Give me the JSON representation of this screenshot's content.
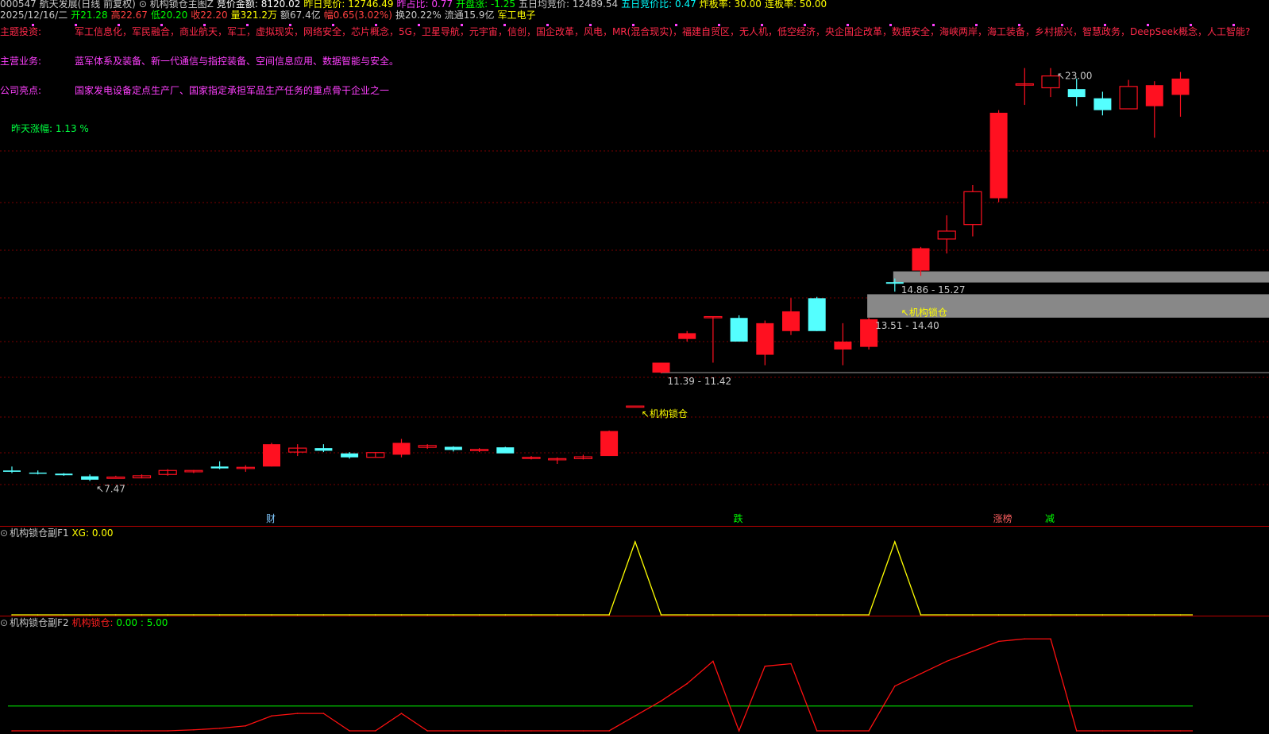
{
  "header": {
    "row1": [
      {
        "t": "000547 航天发展(日线 前复权)",
        "c": "#c8c8c8"
      },
      {
        "t": "⊙ 机构锁仓主图Z",
        "c": "#c8c8c8"
      },
      {
        "t": "竞价金额: 8120.02",
        "c": "#ffffff"
      },
      {
        "t": "昨日竞价: 12746.49",
        "c": "#ffff00"
      },
      {
        "t": "昨占比: 0.77",
        "c": "#ff40ff"
      },
      {
        "t": "开盘涨: -1.25",
        "c": "#00ff00"
      },
      {
        "t": "五日均竞价: 12489.54",
        "c": "#c8c8c8"
      },
      {
        "t": "五日竞价比: 0.47",
        "c": "#00ffff"
      },
      {
        "t": "炸板率: 30.00",
        "c": "#ffff00"
      },
      {
        "t": "连板率: 50.00",
        "c": "#ffff00"
      }
    ],
    "row2": [
      {
        "t": "2025/12/16/二",
        "c": "#c8c8c8"
      },
      {
        "t": "开21.28",
        "c": "#00ff00"
      },
      {
        "t": "高22.67",
        "c": "#ff4040"
      },
      {
        "t": "低20.20",
        "c": "#00ff00"
      },
      {
        "t": "收22.20",
        "c": "#ff4040"
      },
      {
        "t": "量321.2万",
        "c": "#ffff00"
      },
      {
        "t": "额67.4亿",
        "c": "#c8c8c8"
      },
      {
        "t": "幅0.65(3.02%)",
        "c": "#ff4040"
      },
      {
        "t": "换20.22%",
        "c": "#c8c8c8"
      },
      {
        "t": "流通15.9亿",
        "c": "#c8c8c8"
      },
      {
        "t": "军工电子",
        "c": "#ffff00"
      }
    ]
  },
  "info": {
    "theme_label": "主题投资:",
    "theme_text": "军工信息化，军民融合，商业航天，军工，虚拟现实，网络安全，芯片概念，5G，卫星导航，元宇宙，信创，国企改革，风电，MR(混合现实)，福建自贸区，无人机，低空经济，央企国企改革，数据安全，海峡两岸，海工装备，乡村振兴，智慧政务，DeepSeek概念，人工智能?",
    "business_label": "主营业务:",
    "business_text": "蓝军体系及装备、新一代通信与指控装备、空间信息应用、数据智能与安全。",
    "highlight_label": "公司亮点:",
    "highlight_text": "国家发电设备定点生产厂、国家指定承担军品生产任务的重点骨干企业之一",
    "yesterday_text": "昨天涨幅: 1.13 %"
  },
  "colors": {
    "up": "#ff1020",
    "down": "#54ffff",
    "bg": "#000000",
    "grid": "#7a0000",
    "zone": "#888888",
    "xg": "#ffff00",
    "lock": "#ff1010",
    "green": "#00c800"
  },
  "chart_data": [
    {
      "type": "candlestick",
      "ylim": [
        6.5,
        24.5
      ],
      "candles": [
        {
          "o": 7.7,
          "h": 7.85,
          "l": 7.6,
          "c": 7.65
        },
        {
          "o": 7.62,
          "h": 7.7,
          "l": 7.55,
          "c": 7.6
        },
        {
          "o": 7.58,
          "h": 7.6,
          "l": 7.5,
          "c": 7.52
        },
        {
          "o": 7.48,
          "h": 7.55,
          "l": 7.3,
          "c": 7.35
        },
        {
          "o": 7.4,
          "h": 7.5,
          "l": 7.47,
          "c": 7.45
        },
        {
          "o": 7.42,
          "h": 7.55,
          "l": 7.4,
          "c": 7.5
        },
        {
          "o": 7.55,
          "h": 7.75,
          "l": 7.5,
          "c": 7.7
        },
        {
          "o": 7.65,
          "h": 7.72,
          "l": 7.6,
          "c": 7.7
        },
        {
          "o": 7.85,
          "h": 8.05,
          "l": 7.75,
          "c": 7.78
        },
        {
          "o": 7.8,
          "h": 7.9,
          "l": 7.65,
          "c": 7.82
        },
        {
          "o": 7.85,
          "h": 8.75,
          "l": 7.85,
          "c": 8.7
        },
        {
          "o": 8.4,
          "h": 8.7,
          "l": 8.25,
          "c": 8.55
        },
        {
          "o": 8.55,
          "h": 8.7,
          "l": 8.4,
          "c": 8.45
        },
        {
          "o": 8.35,
          "h": 8.4,
          "l": 8.15,
          "c": 8.2
        },
        {
          "o": 8.2,
          "h": 8.4,
          "l": 8.2,
          "c": 8.38
        },
        {
          "o": 8.3,
          "h": 8.9,
          "l": 8.2,
          "c": 8.75
        },
        {
          "o": 8.58,
          "h": 8.7,
          "l": 8.52,
          "c": 8.65
        },
        {
          "o": 8.6,
          "h": 8.62,
          "l": 8.42,
          "c": 8.48
        },
        {
          "o": 8.5,
          "h": 8.55,
          "l": 8.4,
          "c": 8.5
        },
        {
          "o": 8.58,
          "h": 8.6,
          "l": 8.36,
          "c": 8.35
        },
        {
          "o": 8.2,
          "h": 8.25,
          "l": 8.12,
          "c": 8.2
        },
        {
          "o": 8.12,
          "h": 8.2,
          "l": 7.95,
          "c": 8.15
        },
        {
          "o": 8.15,
          "h": 8.3,
          "l": 8.12,
          "c": 8.22
        },
        {
          "o": 8.25,
          "h": 9.22,
          "l": 8.25,
          "c": 9.2
        },
        {
          "o": 10.15,
          "h": 10.15,
          "l": 10.15,
          "c": 10.15
        },
        {
          "o": 11.42,
          "h": 11.8,
          "l": 11.39,
          "c": 11.8
        },
        {
          "o": 12.7,
          "h": 13.0,
          "l": 12.6,
          "c": 12.92
        },
        {
          "o": 13.55,
          "h": 13.55,
          "l": 11.8,
          "c": 13.55
        },
        {
          "o": 13.5,
          "h": 13.6,
          "l": 12.6,
          "c": 12.6
        },
        {
          "o": 12.1,
          "h": 13.4,
          "l": 11.7,
          "c": 13.3
        },
        {
          "o": 13.0,
          "h": 14.25,
          "l": 12.85,
          "c": 13.75
        },
        {
          "o": 14.25,
          "h": 14.3,
          "l": 13.0,
          "c": 13.0
        },
        {
          "o": 12.3,
          "h": 13.3,
          "l": 11.7,
          "c": 12.6
        },
        {
          "o": 12.4,
          "h": 13.5,
          "l": 12.3,
          "c": 13.45
        },
        {
          "o": 14.86,
          "h": 15.0,
          "l": 14.5,
          "c": 14.8
        },
        {
          "o": 15.3,
          "h": 16.2,
          "l": 15.1,
          "c": 16.15
        },
        {
          "o": 16.5,
          "h": 17.4,
          "l": 15.95,
          "c": 16.8
        },
        {
          "o": 17.05,
          "h": 18.55,
          "l": 16.6,
          "c": 18.3
        },
        {
          "o": 18.05,
          "h": 21.4,
          "l": 17.9,
          "c": 21.3
        },
        {
          "o": 22.35,
          "h": 23.0,
          "l": 21.6,
          "c": 22.4
        },
        {
          "o": 22.25,
          "h": 23.0,
          "l": 21.9,
          "c": 22.7
        },
        {
          "o": 22.2,
          "h": 22.6,
          "l": 21.55,
          "c": 21.9
        },
        {
          "o": 21.85,
          "h": 22.1,
          "l": 21.2,
          "c": 21.4
        },
        {
          "o": 21.45,
          "h": 22.55,
          "l": 21.45,
          "c": 22.3
        },
        {
          "o": 21.55,
          "h": 22.5,
          "l": 20.35,
          "c": 22.35
        },
        {
          "o": 21.98,
          "h": 22.85,
          "l": 21.15,
          "c": 22.6
        }
      ],
      "annotations": [
        {
          "text": "↖7.47",
          "i": 3,
          "y": 7.3,
          "color": "#c8c8c8"
        },
        {
          "text": "11.39 - 11.42",
          "i": 25,
          "y": 11.39,
          "color": "#c8c8c8"
        },
        {
          "text": "13.51 - 14.40",
          "i": 33,
          "y": 13.51,
          "color": "#c8c8c8"
        },
        {
          "text": "14.86 - 15.27",
          "i": 34,
          "y": 14.86,
          "color": "#c8c8c8"
        },
        {
          "text": "↖23.00",
          "i": 40,
          "y": 23.0,
          "color": "#c8c8c8"
        },
        {
          "text": "↖机构锁仓",
          "i": 24,
          "y": 10.15,
          "color": "#ffff00"
        },
        {
          "text": "↖机构锁仓",
          "i": 34,
          "y": 14.0,
          "color": "#ffff00"
        }
      ],
      "zones": [
        {
          "from_i": 34,
          "lo": 14.86,
          "hi": 15.27
        },
        {
          "from_i": 33,
          "lo": 13.51,
          "hi": 14.4
        }
      ],
      "levels": [
        {
          "from_i": 25,
          "y": 11.42
        }
      ],
      "events": [
        {
          "text": "财",
          "i": 10,
          "color": "#80c8ff"
        },
        {
          "text": "跌",
          "i": 28,
          "color": "#00ff00"
        },
        {
          "text": "涨榜",
          "i": 38,
          "color": "#ff6060"
        },
        {
          "text": "减",
          "i": 40,
          "color": "#00ff00"
        }
      ]
    },
    {
      "type": "line",
      "title": "机构锁仓副F1",
      "series": [
        {
          "name": "XG",
          "value_label": "0.00",
          "color": "#ffff00",
          "values": [
            0,
            0,
            0,
            0,
            0,
            0,
            0,
            0,
            0,
            0,
            0,
            0,
            0,
            0,
            0,
            0,
            0,
            0,
            0,
            0,
            0,
            0,
            0,
            0,
            1,
            0,
            0,
            0,
            0,
            0,
            0,
            0,
            0,
            0,
            1,
            0,
            0,
            0,
            0,
            0,
            0,
            0,
            0,
            0,
            0,
            0
          ]
        }
      ],
      "ylim": [
        0,
        1
      ]
    },
    {
      "type": "line",
      "title": "机构锁仓副F2",
      "series": [
        {
          "name": "机构锁仓",
          "value_label": "0.00 : 5.00",
          "color": "#ff1010",
          "values": [
            0,
            0,
            0,
            0,
            0,
            0,
            0,
            0.2,
            0.5,
            1.0,
            3.0,
            3.5,
            3.5,
            0,
            0,
            3.5,
            0,
            0,
            0,
            0,
            0,
            0,
            0,
            0,
            3.0,
            6.0,
            9.5,
            14.0,
            0,
            13.0,
            13.5,
            0,
            0,
            0,
            9.0,
            11.5,
            14.0,
            16.0,
            18.0,
            18.5,
            18.5,
            0,
            0,
            0,
            0,
            0
          ]
        }
      ],
      "reference_line": 5,
      "ylim": [
        0,
        19.5
      ]
    }
  ]
}
